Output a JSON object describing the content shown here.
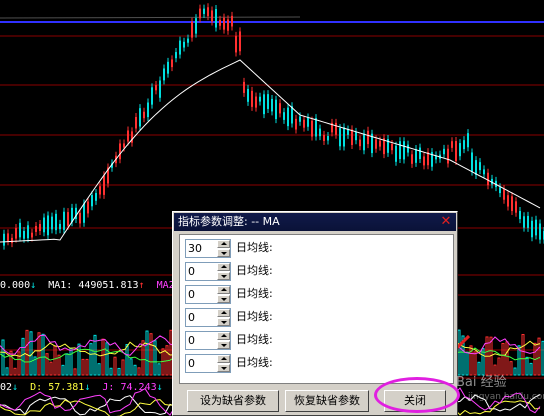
{
  "chart": {
    "ma_readout": {
      "value": "0.000",
      "ma1_label": "MA1:",
      "ma1_value": "449051.813",
      "ma2_label": "MA2",
      "arrow": "↓",
      "ma1_arrow": "↑",
      "value_color": "#ffffff",
      "ma1_color": "#ffffff",
      "ma2_color": "#ff40ff"
    },
    "kdj_readout": {
      "k_partial": "02",
      "k_arrow": "↓",
      "d_label": "D:",
      "d_value": "57.381",
      "d_arrow": "↓",
      "j_label": "J:",
      "j_value": "74.243",
      "j_arrow": "↓",
      "d_color": "#ffff40",
      "j_color": "#ff40ff"
    }
  },
  "dialog": {
    "title": "指标参数调整: -- MA",
    "close_glyph": "✕",
    "params": [
      {
        "value": "30",
        "label": "日均线:"
      },
      {
        "value": "0",
        "label": "日均线:"
      },
      {
        "value": "0",
        "label": "日均线:"
      },
      {
        "value": "0",
        "label": "日均线:"
      },
      {
        "value": "0",
        "label": "日均线:"
      },
      {
        "value": "0",
        "label": "日均线:"
      }
    ],
    "buttons": {
      "set_default": "设为缺省参数",
      "restore_default": "恢复缺省参数",
      "close": "关闭"
    }
  },
  "watermark": {
    "text": "Bai 经验",
    "sub": "jingyan.baidu.com"
  },
  "colors": {
    "up_candle": "#ff3030",
    "down_candle": "#00e0e0",
    "ma_line": "#ffffff",
    "grid_line": "#8b0000",
    "top_line": "#3030ff",
    "annotation": "#e020e0"
  }
}
